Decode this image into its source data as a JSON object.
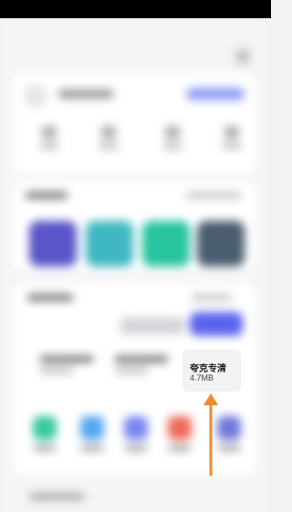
{
  "highlighted_app": {
    "name": "夸克专清",
    "size": "4.7MB"
  },
  "colors": {
    "arrow": "#f08a2c",
    "accent": "#5a63ee",
    "tiles": [
      "#5a55c8",
      "#3fb8c2",
      "#28c4a0",
      "#4a5d70"
    ],
    "apps": [
      "#38c9a0",
      "#53a8f0",
      "#7a86f0",
      "#f06a5a",
      "#7078d8"
    ]
  },
  "icons": [
    "close-icon",
    "arrow-up-icon"
  ]
}
